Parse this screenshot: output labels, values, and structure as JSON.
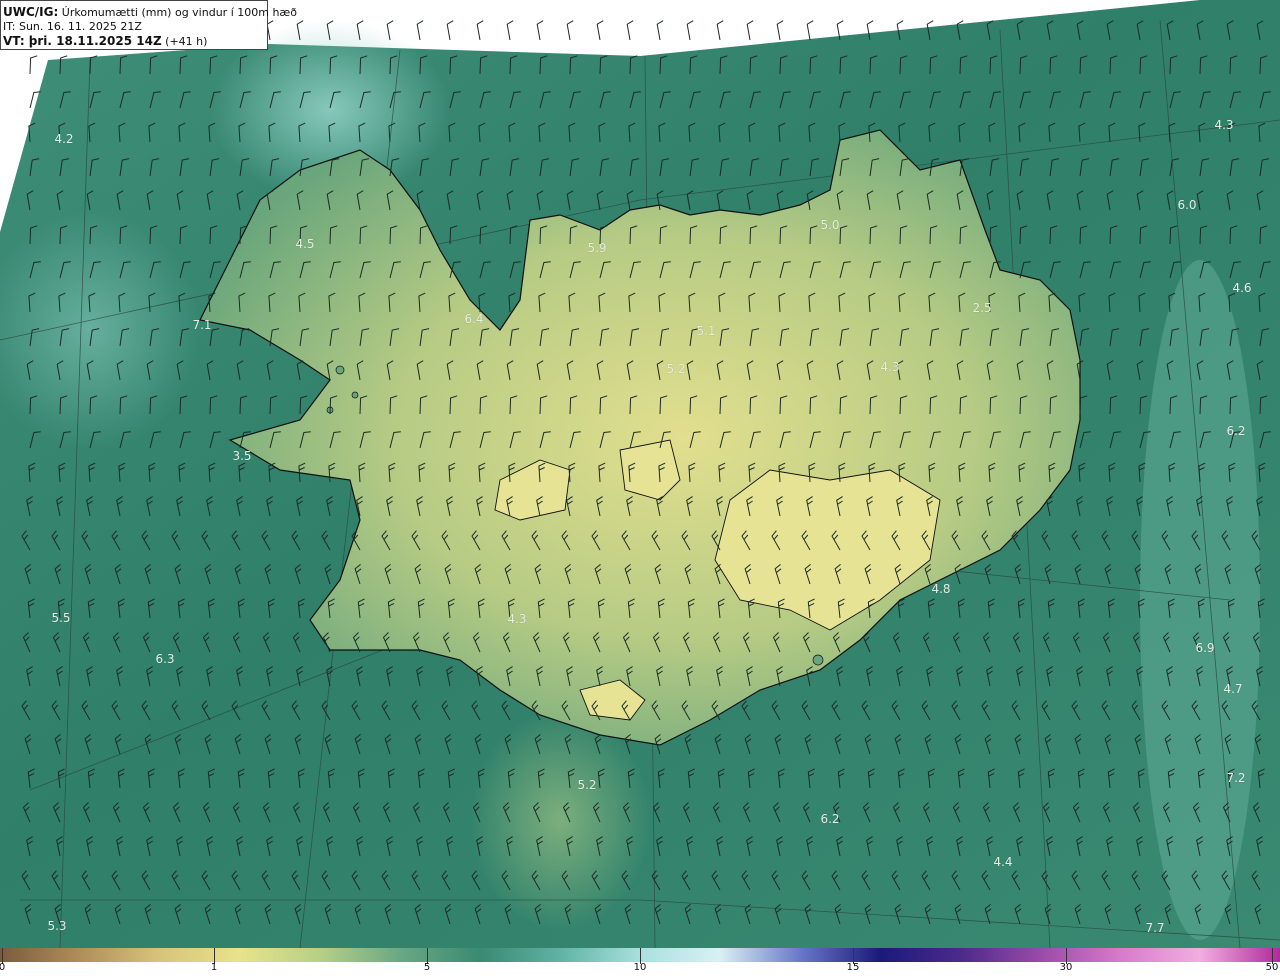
{
  "header": {
    "model": "UWC/IG:",
    "description": " Úrkomumætti (mm) og vindur í 100m hæð",
    "initial_time": "IT: Sun. 16. 11. 2025 21Z",
    "valid_prefix": "VT: þri. 18.11.2025 14Z",
    "valid_offset": " (+41 h)"
  },
  "map_labels": [
    {
      "value": "4.2",
      "pos": [
        64,
        139
      ]
    },
    {
      "value": "4.5",
      "pos": [
        305,
        244
      ]
    },
    {
      "value": "7.1",
      "pos": [
        202,
        325
      ]
    },
    {
      "value": "6.4",
      "pos": [
        474,
        319
      ]
    },
    {
      "value": "5.9",
      "pos": [
        597,
        248
      ]
    },
    {
      "value": "5.0",
      "pos": [
        830,
        225
      ]
    },
    {
      "value": "5.1",
      "pos": [
        706,
        331
      ]
    },
    {
      "value": "5.2",
      "pos": [
        676,
        369
      ]
    },
    {
      "value": "2.5",
      "pos": [
        982,
        308
      ]
    },
    {
      "value": "4.3",
      "pos": [
        890,
        367
      ]
    },
    {
      "value": "4.3",
      "pos": [
        1224,
        125
      ]
    },
    {
      "value": "6.0",
      "pos": [
        1187,
        205
      ]
    },
    {
      "value": "4.6",
      "pos": [
        1242,
        288
      ]
    },
    {
      "value": "6.2",
      "pos": [
        1236,
        431
      ]
    },
    {
      "value": "3.5",
      "pos": [
        242,
        456
      ]
    },
    {
      "value": "4.8",
      "pos": [
        941,
        589
      ]
    },
    {
      "value": "5.5",
      "pos": [
        61,
        618
      ]
    },
    {
      "value": "4.3",
      "pos": [
        517,
        619
      ]
    },
    {
      "value": "6.3",
      "pos": [
        165,
        659
      ]
    },
    {
      "value": "6.9",
      "pos": [
        1205,
        648
      ]
    },
    {
      "value": "4.7",
      "pos": [
        1233,
        689
      ]
    },
    {
      "value": "7.2",
      "pos": [
        1236,
        778
      ]
    },
    {
      "value": "5.2",
      "pos": [
        587,
        785
      ]
    },
    {
      "value": "6.2",
      "pos": [
        830,
        819
      ]
    },
    {
      "value": "4.4",
      "pos": [
        1003,
        862
      ]
    },
    {
      "value": "5.3",
      "pos": [
        57,
        926
      ]
    },
    {
      "value": "7.7",
      "pos": [
        1155,
        928
      ]
    }
  ],
  "colorbar": {
    "ticks": [
      {
        "label": "0",
        "pos": 2
      },
      {
        "label": "1",
        "pos": 214
      },
      {
        "label": "5",
        "pos": 427
      },
      {
        "label": "10",
        "pos": 640
      },
      {
        "label": "15",
        "pos": 853
      },
      {
        "label": "30",
        "pos": 1066
      },
      {
        "label": "50",
        "pos": 1272
      }
    ],
    "colors": [
      "#7a5c3c",
      "#b08e5a",
      "#d7c47a",
      "#e7e38b",
      "#b7cf86",
      "#6aa884",
      "#3a8a72",
      "#5fb3a4",
      "#a9e0df",
      "#d9f0f4",
      "#6a78c8",
      "#1a1a7a",
      "#4b2a8a",
      "#9a4aa8",
      "#d77acb",
      "#f2aee0",
      "#b02a9a"
    ]
  },
  "colors": {
    "sea": "#3b8a72",
    "land_light": "#d9d98a",
    "land_mid": "#9bbf7f",
    "coast": "#111111",
    "outside": "#ffffff"
  }
}
